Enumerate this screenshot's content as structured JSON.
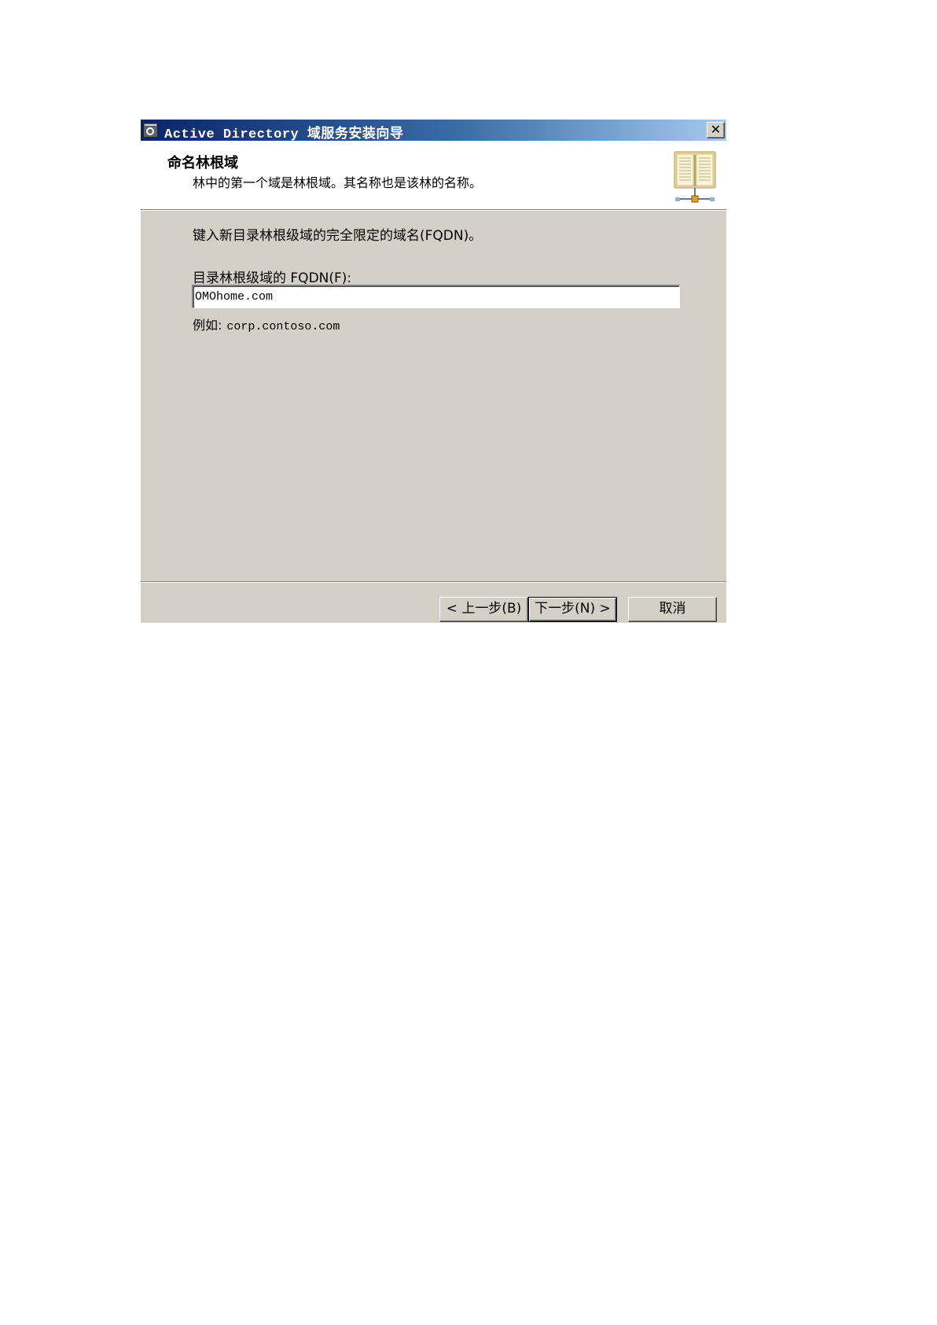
{
  "window": {
    "title": "Active Directory 域服务安装向导",
    "close_label": "✕"
  },
  "header": {
    "title": "命名林根域",
    "subtitle": "林中的第一个域是林根域。其名称也是该林的名称。",
    "icon": "book-icon"
  },
  "main": {
    "instruction": "键入新目录林根级域的完全限定的域名(FQDN)。",
    "fqdn_label": "目录林根级域的 FQDN(F):",
    "fqdn_value": "OMOhome.com",
    "example_label": "例如:",
    "example_value": "corp.contoso.com"
  },
  "footer": {
    "back_label": "< 上一步(B)",
    "next_label": "下一步(N) >",
    "cancel_label": "取消"
  },
  "colors": {
    "dialog_bg": "#d4d0c8",
    "title_gradient_start": "#0a246a",
    "title_gradient_end": "#a6caf0"
  }
}
